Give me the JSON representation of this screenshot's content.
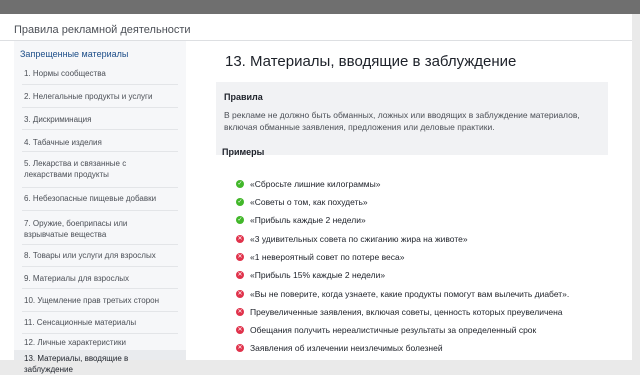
{
  "header": {
    "title": "Правила рекламной деятельности"
  },
  "sidebar": {
    "heading": "Запрещенные материалы",
    "items": [
      {
        "label": "1. Нормы сообщества"
      },
      {
        "label": "2. Нелегальные продукты и услуги"
      },
      {
        "label": "3. Дискриминация"
      },
      {
        "label": "4. Табачные изделия"
      },
      {
        "label": "5. Лекарства и связанные с лекарствами продукты"
      },
      {
        "label": "6. Небезопасные пищевые добавки"
      },
      {
        "label": "7. Оружие, боеприпасы или взрывчатые вещества"
      },
      {
        "label": "8. Товары или услуги для взрослых"
      },
      {
        "label": "9. Материалы для взрослых"
      },
      {
        "label": "10. Ущемление прав третьих сторон"
      },
      {
        "label": "11. Сенсационные материалы"
      },
      {
        "label": "12. Личные характеристики"
      },
      {
        "label": "13. Материалы, вводящие в заблуждение"
      }
    ]
  },
  "main": {
    "title": "13. Материалы, вводящие в заблуждение",
    "rules_heading": "Правила",
    "rules_text": "В рекламе не должно быть обманных, ложных или вводящих в заблуждение материалов, включая обманные заявления, предложения или деловые практики.",
    "examples_heading": "Примеры",
    "examples": [
      {
        "type": "good",
        "icon": "check-icon",
        "text": "«Сбросьте лишние килограммы»"
      },
      {
        "type": "good",
        "icon": "check-icon",
        "text": "«Советы о том, как похудеть»"
      },
      {
        "type": "good",
        "icon": "check-icon",
        "text": "«Прибыль каждые 2 недели»"
      },
      {
        "type": "bad",
        "icon": "cross-icon",
        "text": "«3 удивительных совета по сжиганию жира на животе»"
      },
      {
        "type": "bad",
        "icon": "cross-icon",
        "text": "«1 невероятный совет по потере веса»"
      },
      {
        "type": "bad",
        "icon": "cross-icon",
        "text": "«Прибыль 15% каждые 2 недели»"
      },
      {
        "type": "bad",
        "icon": "cross-icon",
        "text": "«Вы не поверите, когда узнаете, какие продукты помогут вам вылечить диабет»."
      },
      {
        "type": "bad",
        "icon": "cross-icon",
        "text": "Преувеличенные заявления, включая советы, ценность которых преувеличена"
      },
      {
        "type": "bad",
        "icon": "cross-icon",
        "text": "Обещания получить нереалистичные результаты за определенный срок"
      },
      {
        "type": "bad",
        "icon": "cross-icon",
        "text": "Заявления об излечении неизлечимых болезней"
      }
    ]
  },
  "colors": {
    "accent": "#1d4e89",
    "good": "#42b72a",
    "bad": "#e0324b",
    "panel": "#f6f7f9"
  }
}
